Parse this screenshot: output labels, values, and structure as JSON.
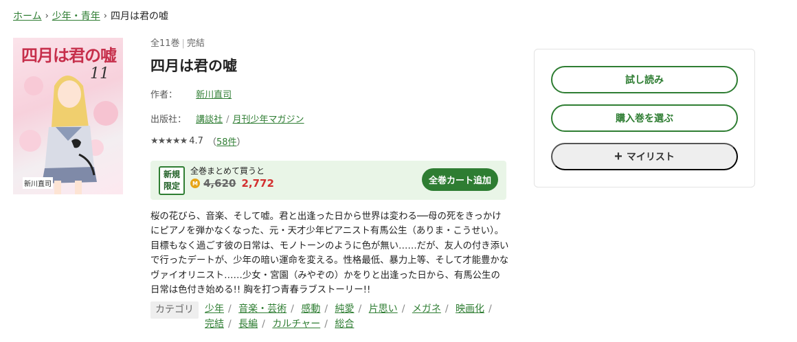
{
  "breadcrumb": {
    "home": "ホーム",
    "category": "少年・青年",
    "current": "四月は君の嘘"
  },
  "cover": {
    "title": "四月は君の嘘",
    "volume": "11",
    "author": "新川直司"
  },
  "book": {
    "volumes": "全11巻",
    "status": "完結",
    "title": "四月は君の嘘",
    "author_label": "作者：",
    "author": "新川直司",
    "publisher_label": "出版社：",
    "publisher": "講談社",
    "magazine": "月刊少年マガジン",
    "rating": "4.7",
    "rating_stars": 5,
    "review_count_open": "（",
    "review_count": "58件",
    "review_count_close": "）"
  },
  "promo": {
    "badge_line1": "新規",
    "badge_line2": "限定",
    "text": "全巻まとめて買うと",
    "coin_icon": "M",
    "old_price": "4,620",
    "new_price": "2,772",
    "cart_button": "全巻カート追加"
  },
  "description": "桜の花びら、音楽、そして嘘。君と出逢った日から世界は変わる──母の死をきっかけにピアノを弾かなくなった、元・天才少年ピアニスト有馬公生（ありま・こうせい）。目標もなく過ごす彼の日常は、モノトーンのように色が無い……だが、友人の付き添いで行ったデートが、少年の暗い運命を変える。性格最低、暴力上等、そして才能豊かなヴァイオリニスト……少女・宮園（みやぞの）かをりと出逢った日から、有馬公生の日常は色付き始める!! 胸を打つ青春ラブストーリー!!",
  "categories": {
    "label": "カテゴリ",
    "items": [
      "少年",
      "音楽・芸術",
      "感動",
      "純愛",
      "片思い",
      "メガネ",
      "映画化",
      "完結",
      "長編",
      "カルチャー",
      "総合"
    ]
  },
  "sidebar": {
    "trial_button": "試し読み",
    "select_volume_button": "購入巻を選ぶ",
    "mylist_icon": "+",
    "mylist_button": "マイリスト"
  },
  "colors": {
    "accent": "#2e7d32",
    "sale_price": "#d32f2f",
    "promo_bg": "#e9f5e7"
  }
}
